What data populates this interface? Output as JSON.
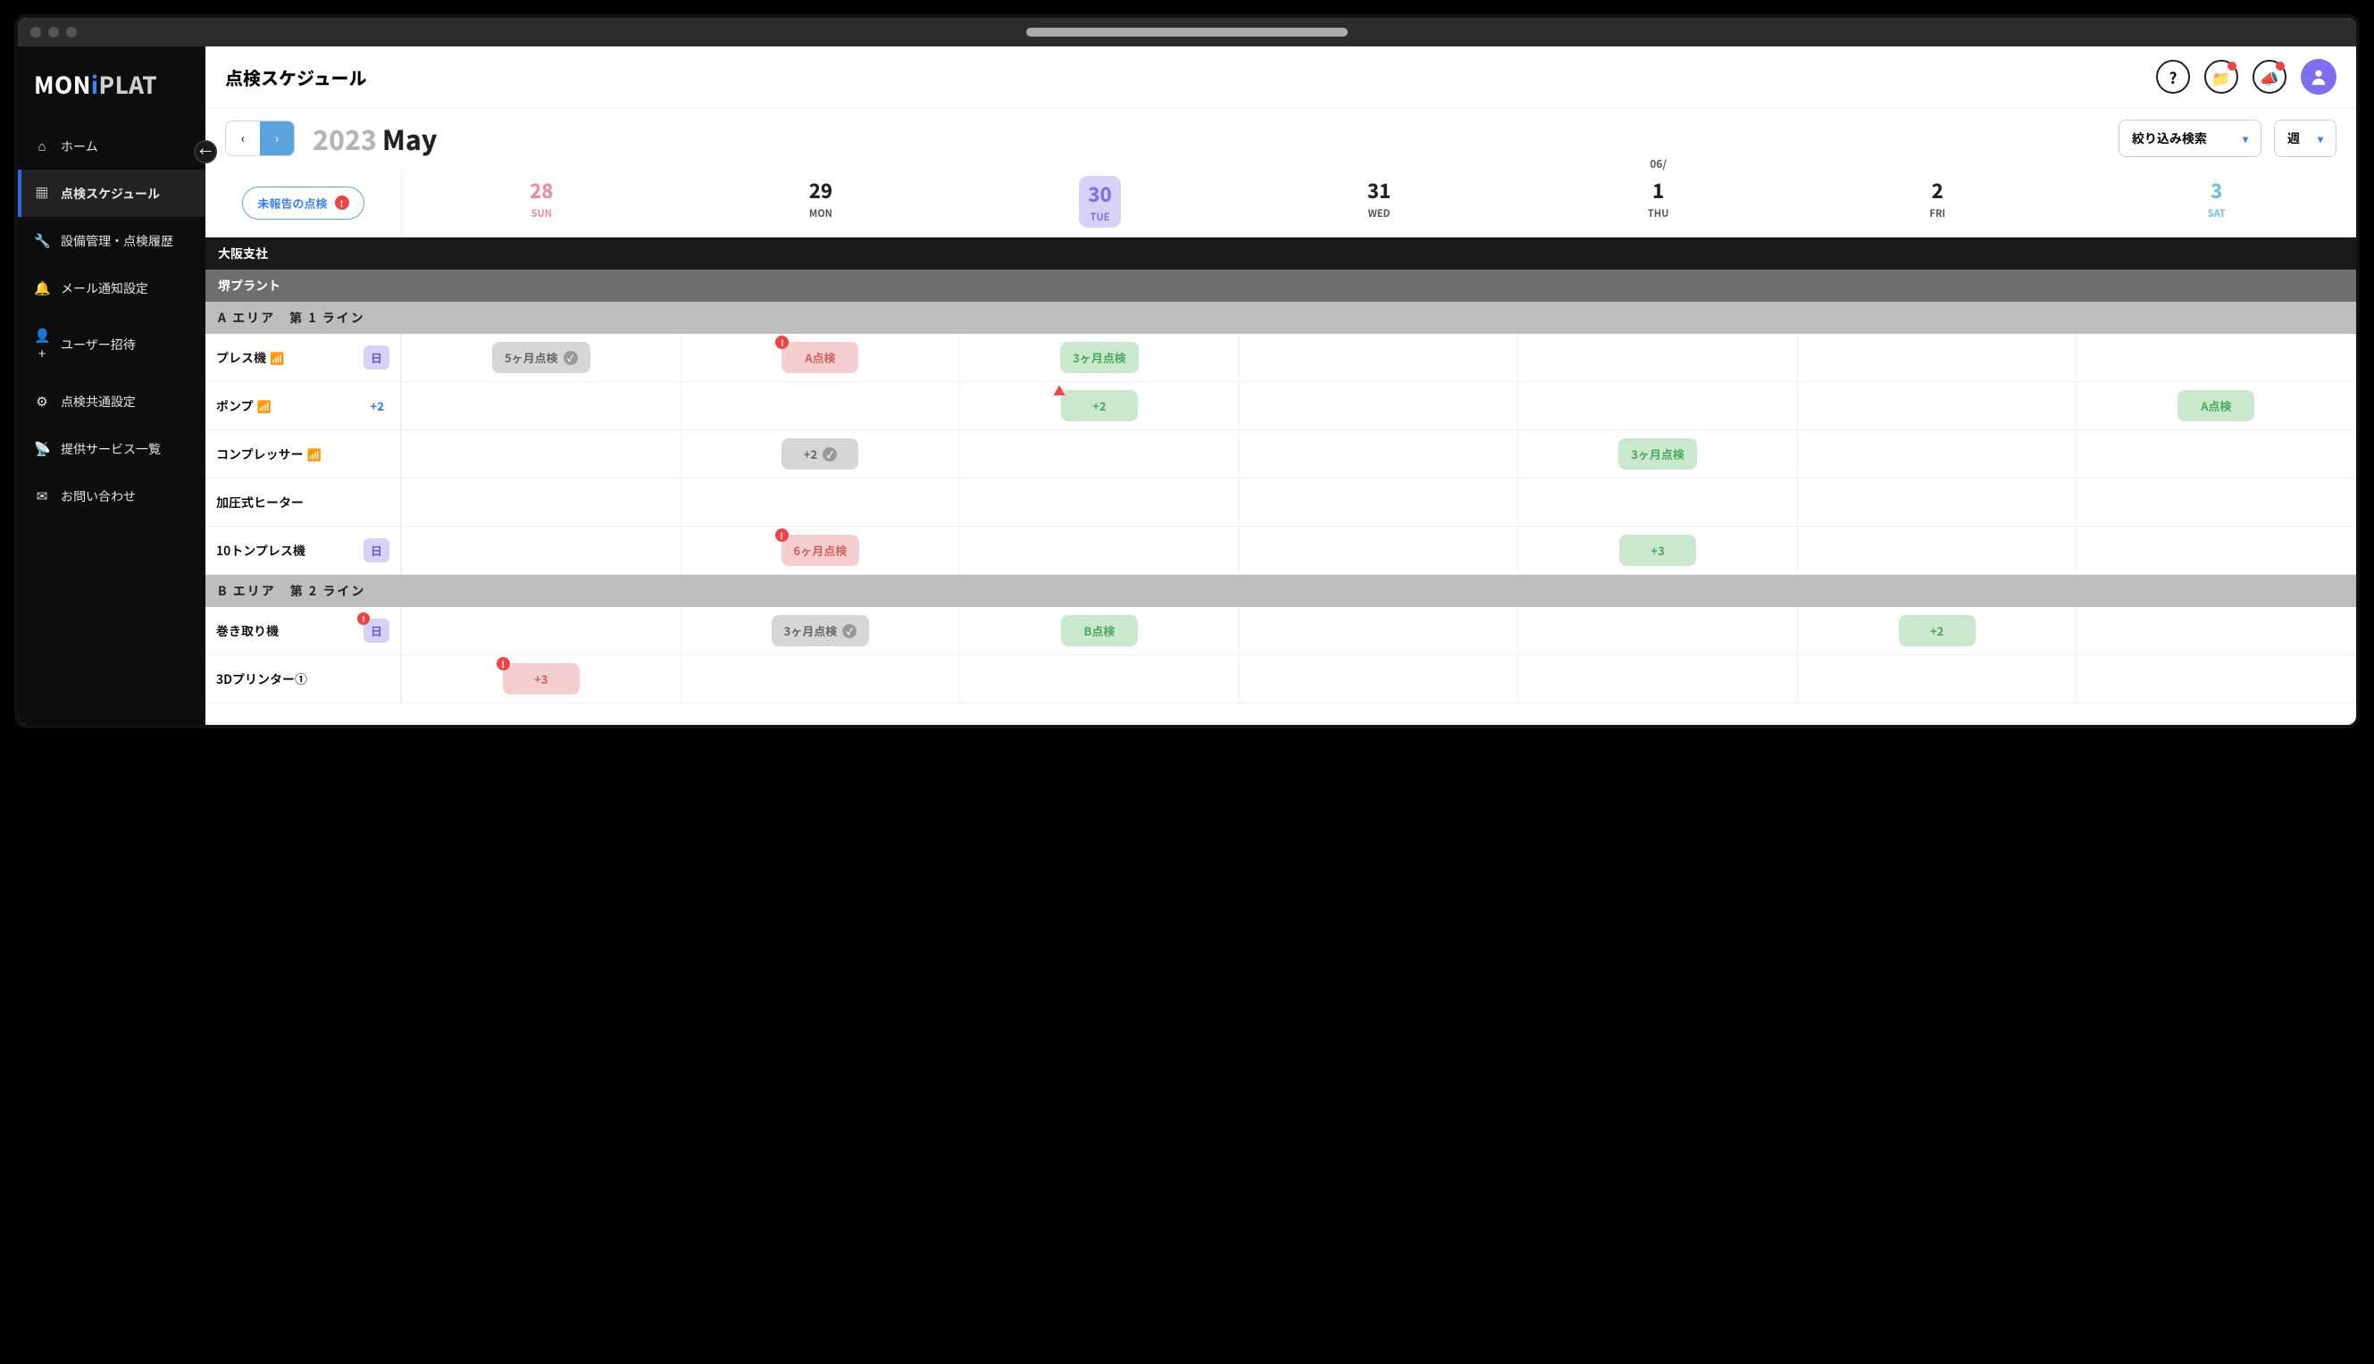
{
  "logo": {
    "p1": "MON",
    "p2": "i",
    "p3": "PLAT"
  },
  "nav": [
    {
      "icon": "⌂",
      "label": "ホーム"
    },
    {
      "icon": "▦",
      "label": "点検スケジュール",
      "active": true
    },
    {
      "icon": "🔧",
      "label": "設備管理・点検履歴"
    },
    {
      "icon": "🔔",
      "label": "メール通知設定"
    },
    {
      "icon": "👤+",
      "label": "ユーザー招待"
    },
    {
      "icon": "⚙",
      "label": "点検共通設定"
    },
    {
      "icon": "📡",
      "label": "提供サービス一覧"
    },
    {
      "icon": "✉",
      "label": "お問い合わせ"
    }
  ],
  "page_title": "点検スケジュール",
  "year": "2023",
  "month": "May",
  "filter_label": "絞り込み検索",
  "view_label": "週",
  "unreported_label": "未報告の点検",
  "next_month_label": "06/",
  "days": [
    {
      "num": "28",
      "dow": "SUN",
      "cls": "sun"
    },
    {
      "num": "29",
      "dow": "MON"
    },
    {
      "num": "30",
      "dow": "TUE",
      "selected": true
    },
    {
      "num": "31",
      "dow": "WED"
    },
    {
      "num": "1",
      "dow": "THU",
      "month_label": true
    },
    {
      "num": "2",
      "dow": "FRI"
    },
    {
      "num": "3",
      "dow": "SAT",
      "cls": "sat"
    }
  ],
  "sec1": "大阪支社",
  "sec2": "堺プラント",
  "sec3a": "A エリア　第 1 ライン",
  "sec3b": "B エリア　第 2 ライン",
  "rows_a": [
    {
      "name": "プレス機",
      "wifi": true,
      "badge": "日",
      "cells": [
        {
          "type": "gray",
          "text": "5ヶ月点検",
          "check": true
        },
        {
          "type": "red",
          "text": "A点検",
          "alert": true
        },
        {
          "type": "green",
          "text": "3ヶ月点検"
        },
        null,
        null,
        null,
        null
      ]
    },
    {
      "name": "ポンプ",
      "wifi": true,
      "count": "+2",
      "cells": [
        null,
        null,
        {
          "type": "green",
          "text": "+2",
          "warn": true
        },
        null,
        null,
        null,
        {
          "type": "green",
          "text": "A点検"
        }
      ]
    },
    {
      "name": "コンプレッサー",
      "wifi": true,
      "cells": [
        null,
        {
          "type": "gray",
          "text": "+2",
          "check": true
        },
        null,
        null,
        {
          "type": "green",
          "text": "3ヶ月点検"
        },
        null,
        null
      ]
    },
    {
      "name": "加圧式ヒーター",
      "cells": [
        null,
        null,
        null,
        null,
        null,
        null,
        null
      ]
    },
    {
      "name": "10トンプレス機",
      "badge": "日",
      "cells": [
        null,
        {
          "type": "red",
          "text": "6ヶ月点検",
          "alert": true
        },
        null,
        null,
        {
          "type": "green",
          "text": "+3"
        },
        null,
        null
      ]
    }
  ],
  "rows_b": [
    {
      "name": "巻き取り機",
      "badge": "日",
      "badge_alert": true,
      "cells": [
        null,
        {
          "type": "gray",
          "text": "3ヶ月点検",
          "check": true
        },
        {
          "type": "green",
          "text": "B点検"
        },
        null,
        null,
        {
          "type": "green",
          "text": "+2"
        },
        null
      ]
    },
    {
      "name": "3Dプリンター①",
      "cells": [
        {
          "type": "red",
          "text": "+3",
          "alert": true
        },
        null,
        null,
        null,
        null,
        null,
        null
      ]
    }
  ]
}
